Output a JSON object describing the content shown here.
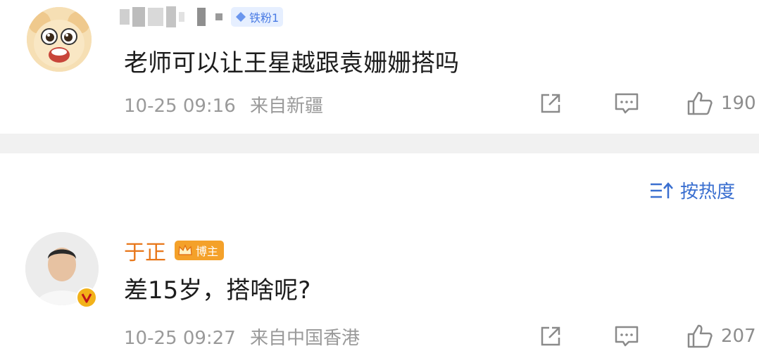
{
  "comments": [
    {
      "username_redacted": true,
      "badge": {
        "icon": "diamond-icon",
        "label": "铁粉1",
        "color": "#4a7be4"
      },
      "text": "老师可以让王星越跟袁姗姗搭吗",
      "time": "10-25 09:16",
      "location": "来自新疆",
      "likes": "190"
    },
    {
      "username": "于正",
      "badge": {
        "icon": "crown-icon",
        "label": "博主",
        "color": "#f4a12a"
      },
      "verified": "v-badge-icon",
      "text": "差15岁，搭啥呢?",
      "time": "10-25 09:27",
      "location": "来自中国香港",
      "likes": "207"
    }
  ],
  "sort": {
    "label": "按热度",
    "icon": "sort-icon"
  },
  "colors": {
    "accent": "#3a6fd0",
    "username": "#e8771a",
    "meta": "#9a9a9a",
    "divider": "#f1f1f1"
  }
}
